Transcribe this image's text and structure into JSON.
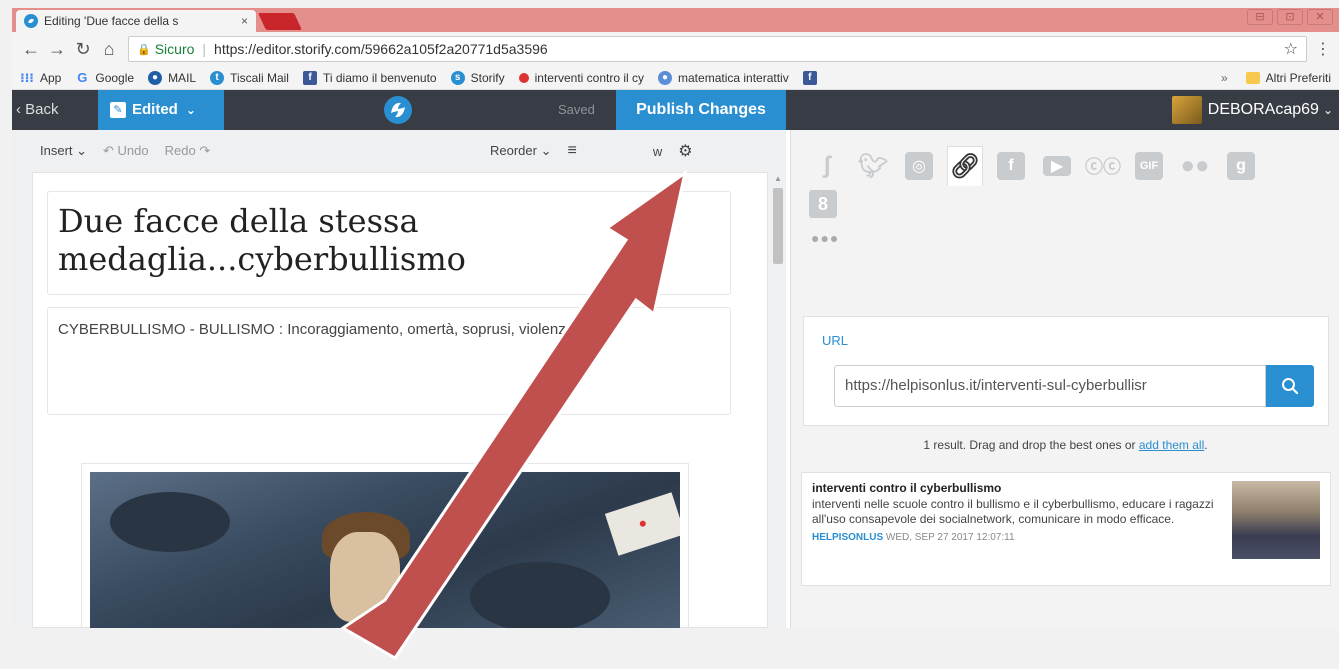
{
  "browser": {
    "tab_title": "Editing 'Due facce della s",
    "tab_close": "×",
    "window_min": "⊟",
    "window_max": "⊡",
    "window_close": "✕",
    "secure_label": "Sicuro",
    "separator": "|",
    "url": "https://editor.storify.com/59662a105f2a20771d5a3596",
    "bookmarks": [
      {
        "label": "App",
        "icon": "apps-icon"
      },
      {
        "label": "Google",
        "icon": "google-icon"
      },
      {
        "label": "MAIL",
        "icon": "mail-icon"
      },
      {
        "label": "Tiscali Mail",
        "icon": "tiscali-icon"
      },
      {
        "label": "Ti diamo il benvenuto",
        "icon": "facebook-icon"
      },
      {
        "label": "Storify",
        "icon": "storify-icon"
      },
      {
        "label": "interventi contro il cy",
        "icon": "bookmark-icon"
      },
      {
        "label": "matematica interattiv",
        "icon": "bookmark-icon"
      }
    ],
    "bookmarks_overflow": "»",
    "other_bookmarks": "Altri Preferiti"
  },
  "app": {
    "back_label": "‹ Back",
    "edited_label": "Edited",
    "saved_label": "Saved",
    "publish_label": "Publish Changes",
    "username": "DEBORAcap69"
  },
  "toolbar": {
    "insert": "Insert ⌄",
    "undo": "Undo",
    "redo": "Redo",
    "reorder": "Reorder ⌄",
    "view_fragment": "w"
  },
  "story": {
    "title": "Due facce della stessa medaglia...cyberbullismo",
    "description": "CYBERBULLISMO - BULLISMO : Incoraggiamento, omertà, soprusi, violenze etc"
  },
  "sources": {
    "url_label": "URL",
    "url_value": "https://helpisonlus.it/interventi-sul-cyberbullisr",
    "more": "●●●",
    "results_text": "1 result. Drag and drop the best ones or",
    "results_link": "add them all",
    "results_end": "."
  },
  "result": {
    "title": "interventi contro il cyberbullismo",
    "description": "interventi nelle scuole contro il bullismo e il cyberbullismo, educare i ragazzi all'uso consapevole dei socialnetwork, comunicare in modo efficace.",
    "source": "HELPISONLUS",
    "date": "WED, SEP 27 2017 12:07:11"
  },
  "colors": {
    "accent": "#2a8fd1",
    "appbar": "#383d45",
    "arrow": "#c0504d"
  }
}
